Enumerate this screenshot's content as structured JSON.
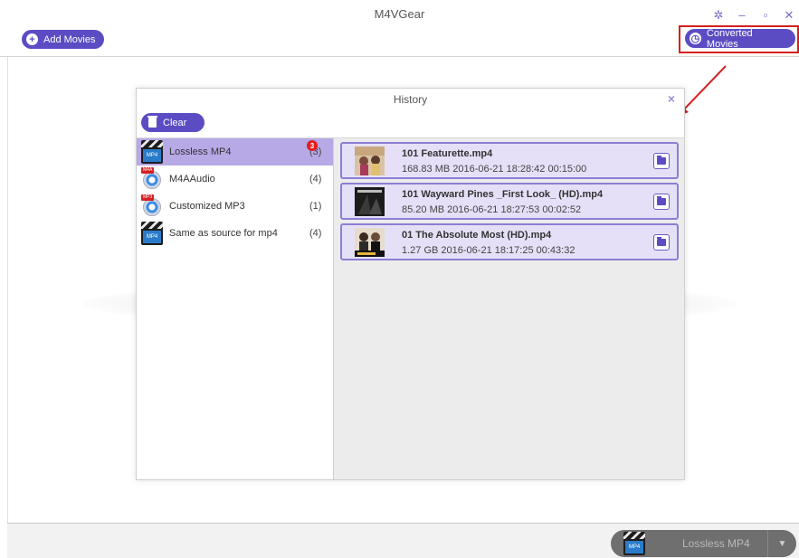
{
  "app": {
    "title": "M4VGear"
  },
  "toolbar": {
    "add_movies_label": "Add Movies",
    "converted_movies_label": "Converted Movies",
    "settings_icon": "gear-icon",
    "minimize_icon": "minimize-icon",
    "maximize_icon": "maximize-icon",
    "close_icon": "close-icon"
  },
  "history": {
    "title": "History",
    "clear_label": "Clear",
    "close_glyph": "×",
    "formats": [
      {
        "label": "Lossless MP4",
        "count": "(3)",
        "badge": "3",
        "selected": true,
        "icon": "mp4-clapper-icon"
      },
      {
        "label": "M4AAudio",
        "count": "(4)",
        "selected": false,
        "icon": "m4a-disc-icon"
      },
      {
        "label": "Customized MP3",
        "count": "(1)",
        "selected": false,
        "icon": "mp3-disc-icon"
      },
      {
        "label": "Same as source for mp4",
        "count": "(4)",
        "selected": false,
        "icon": "mp4-clapper-icon"
      }
    ],
    "items": [
      {
        "name": "101 Featurette.mp4",
        "meta": "168.83 MB   2016-06-21  18:28:42   00:15:00"
      },
      {
        "name": "101 Wayward Pines _First Look_ (HD).mp4",
        "meta": "85.20 MB   2016-06-21  18:27:53   00:02:52"
      },
      {
        "name": "01 The Absolute Most (HD).mp4",
        "meta": "1.27 GB   2016-06-21  18:17:25   00:43:32"
      }
    ]
  },
  "output": {
    "format_label": "Lossless MP4",
    "icon": "mp4-clapper-icon"
  },
  "colors": {
    "accent": "#5b4cc4",
    "selected_row": "#b7a8e6",
    "annotation_red": "#d62020"
  }
}
